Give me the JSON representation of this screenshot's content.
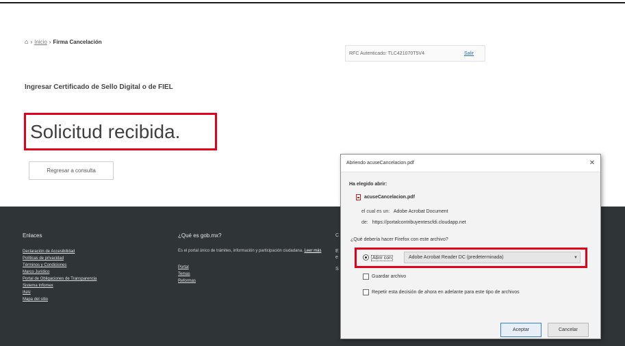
{
  "breadcrumb": {
    "home_icon": "home-icon",
    "separator": "›",
    "link": "Inicio",
    "current": "Firma Cancelación"
  },
  "session": {
    "rfc_text": "RFC Autenticado: TLC421070T5V4",
    "exit_label": "Salir"
  },
  "subtitle": "Ingresar Certificado de Sello Digital o de FIEL",
  "heading": "Solicitud recibida.",
  "return_button": "Regresar a consulta",
  "footer": {
    "col1": {
      "title": "Enlaces",
      "links": [
        "Declaración de Accesibilidad",
        "Políticas de privacidad",
        "Términos y Condiciones",
        "Marco Jurídico",
        "Portal de Obligaciones de Transparencia",
        "Sistema Infomex",
        "INAI",
        "Mapa del sitio"
      ]
    },
    "col2": {
      "title": "¿Qué es gob.mx?",
      "text": "Es el portal único de trámites, información y participación ciudadana.",
      "text_link": "Leer más",
      "links": [
        "Portal",
        "Temas",
        "Reformas"
      ]
    },
    "col3": {
      "frag_top": "C",
      "frag_mid": "E",
      "frag_mid2": "e",
      "frag_bottom": "S"
    }
  },
  "dialog": {
    "title": "Abriendo acuseCancelacion.pdf",
    "close": "✕",
    "section_label": "Ha elegido abrir:",
    "file_name": "acuseCancelacion.pdf",
    "type_label": "el cual es un:",
    "type_value": "Adobe Acrobat Document",
    "from_label": "de:",
    "from_value": "https://portalcontribuyentescfdi.cloudapp.net",
    "question": "¿Qué debería hacer Firefox con este archivo?",
    "open_with_label": "Abrir con",
    "open_with_app": "Adobe Acrobat Reader DC  (predeterminada)",
    "save_label": "Guardar archivo",
    "remember_label": "Repetir esta decisión de ahora en adelante para este tipo de archivos",
    "accept_label": "Aceptar",
    "cancel_label": "Cancelar"
  }
}
